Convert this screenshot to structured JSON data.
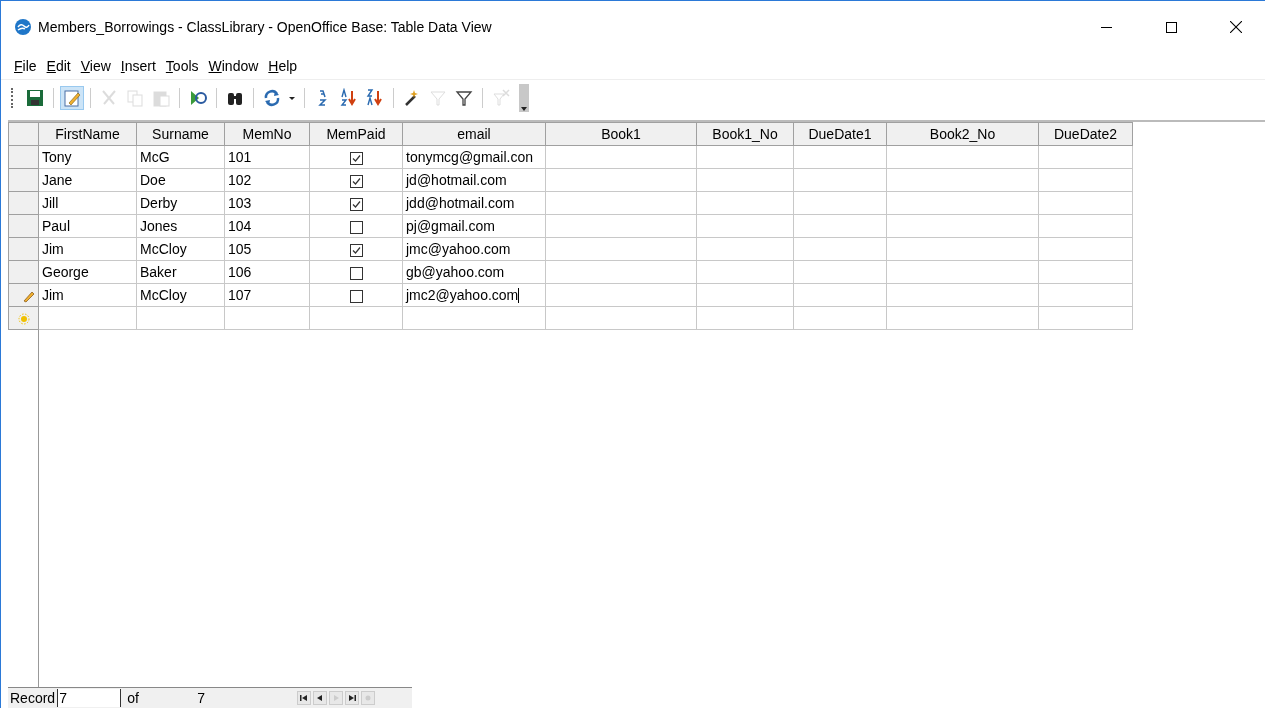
{
  "window": {
    "title": "Members_Borrowings - ClassLibrary - OpenOffice Base: Table Data View"
  },
  "menu": [
    {
      "label": "File"
    },
    {
      "label": "Edit"
    },
    {
      "label": "View"
    },
    {
      "label": "Insert"
    },
    {
      "label": "Tools"
    },
    {
      "label": "Window"
    },
    {
      "label": "Help"
    }
  ],
  "toolbar": [
    {
      "kind": "save",
      "disabled": false,
      "selected": false
    },
    {
      "kind": "sep"
    },
    {
      "kind": "edit",
      "disabled": false,
      "selected": true
    },
    {
      "kind": "sep"
    },
    {
      "kind": "cut",
      "disabled": true,
      "selected": false
    },
    {
      "kind": "copy",
      "disabled": true,
      "selected": false
    },
    {
      "kind": "paste",
      "disabled": true,
      "selected": false
    },
    {
      "kind": "sep"
    },
    {
      "kind": "undo",
      "disabled": false,
      "selected": false
    },
    {
      "kind": "sep"
    },
    {
      "kind": "find",
      "disabled": false,
      "selected": false
    },
    {
      "kind": "sep"
    },
    {
      "kind": "refresh",
      "disabled": false,
      "selected": false
    },
    {
      "kind": "dropdown",
      "disabled": false,
      "selected": false
    },
    {
      "kind": "sep"
    },
    {
      "kind": "sort",
      "disabled": false,
      "selected": false
    },
    {
      "kind": "sortasc",
      "disabled": false,
      "selected": false
    },
    {
      "kind": "sortdesc",
      "disabled": false,
      "selected": false
    },
    {
      "kind": "sep"
    },
    {
      "kind": "autofilter",
      "disabled": false,
      "selected": false
    },
    {
      "kind": "stdfilter",
      "disabled": true,
      "selected": false
    },
    {
      "kind": "filter",
      "disabled": false,
      "selected": false
    },
    {
      "kind": "sep"
    },
    {
      "kind": "removefilter",
      "disabled": true,
      "selected": false
    },
    {
      "kind": "more"
    }
  ],
  "table": {
    "columns": [
      "FirstName",
      "Surname",
      "MemNo",
      "MemPaid",
      "email",
      "Book1",
      "Book1_No",
      "DueDate1",
      "Book2_No",
      "DueDate2"
    ],
    "rows": [
      {
        "first": "Tony",
        "surname": "McG",
        "memno": "101",
        "paid": true,
        "email": "tonymcg@gmail.con",
        "editing": false
      },
      {
        "first": "Jane",
        "surname": "Doe",
        "memno": "102",
        "paid": true,
        "email": "jd@hotmail.com",
        "editing": false
      },
      {
        "first": "Jill",
        "surname": "Derby",
        "memno": "103",
        "paid": true,
        "email": "jdd@hotmail.com",
        "editing": false
      },
      {
        "first": "Paul",
        "surname": "Jones",
        "memno": "104",
        "paid": false,
        "email": "pj@gmail.com",
        "editing": false
      },
      {
        "first": "Jim",
        "surname": "McCloy",
        "memno": "105",
        "paid": true,
        "email": "jmc@yahoo.com",
        "editing": false
      },
      {
        "first": "George",
        "surname": "Baker",
        "memno": "106",
        "paid": false,
        "email": "gb@yahoo.com",
        "editing": false
      },
      {
        "first": "Jim",
        "surname": "McCloy",
        "memno": "107",
        "paid": false,
        "email": "jmc2@yahoo.com",
        "editing": true
      }
    ]
  },
  "status_bar": {
    "label": "Record",
    "value": "7",
    "of_label": "of",
    "total": "7",
    "nav": [
      {
        "kind": "first",
        "disabled": false
      },
      {
        "kind": "prev",
        "disabled": false
      },
      {
        "kind": "next",
        "disabled": true
      },
      {
        "kind": "last",
        "disabled": false
      },
      {
        "kind": "new",
        "disabled": true
      }
    ]
  }
}
